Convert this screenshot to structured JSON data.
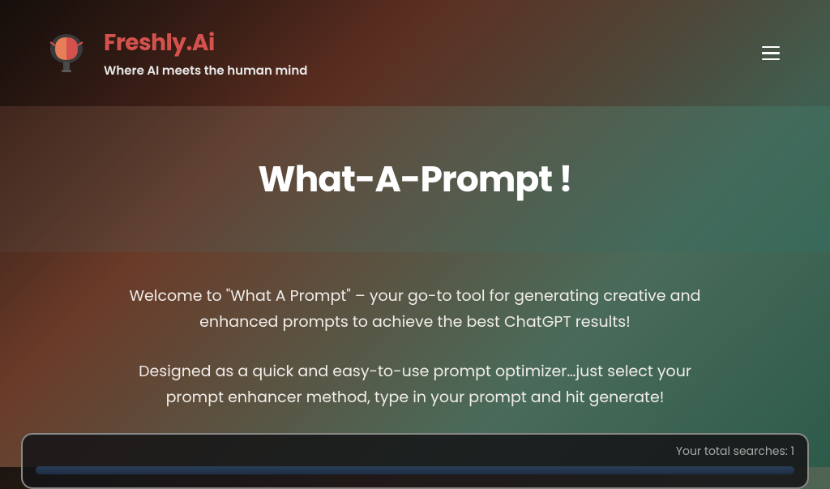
{
  "header": {
    "brand_title": "Freshly.Ai",
    "brand_tagline": "Where AI meets the human mind"
  },
  "hero": {
    "title": "What-A-Prompt !"
  },
  "content": {
    "intro_p1": "Welcome to \"What A Prompt\" – your go-to tool for generating creative and enhanced prompts to achieve the best ChatGPT results!",
    "intro_p2": "Designed as a quick and easy-to-use prompt optimizer…just select your prompt enhancer method, type in your prompt and hit generate!"
  },
  "panel": {
    "search_count": "Your total searches: 1"
  }
}
